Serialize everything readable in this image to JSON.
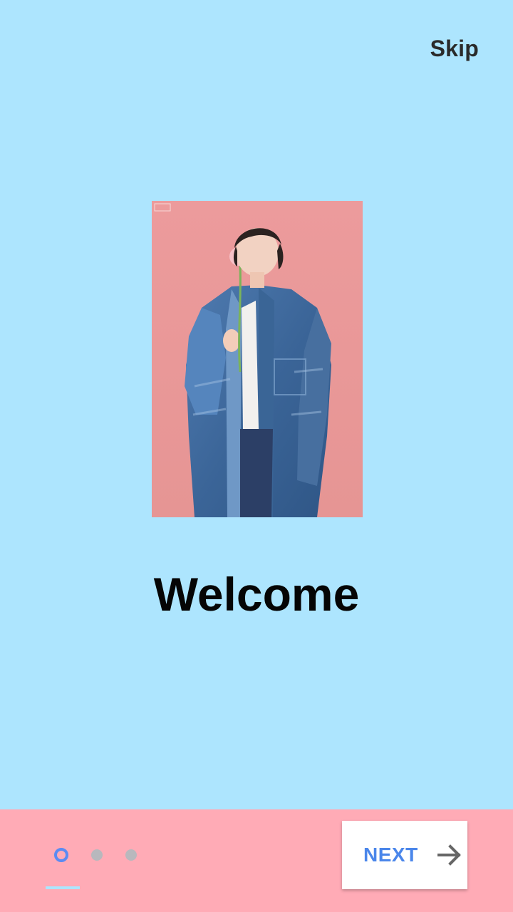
{
  "header": {
    "skip_label": "Skip"
  },
  "slide": {
    "title": "Welcome",
    "image_icon": "portrait-photo"
  },
  "footer": {
    "next_label": "NEXT",
    "next_icon": "arrow-right-icon",
    "page_count": 3,
    "active_page": 1
  },
  "colors": {
    "background": "#ade5fe",
    "footer_background": "#ffabb6",
    "accent": "#4a86ea",
    "inactive_dot": "#b8b8bd"
  }
}
